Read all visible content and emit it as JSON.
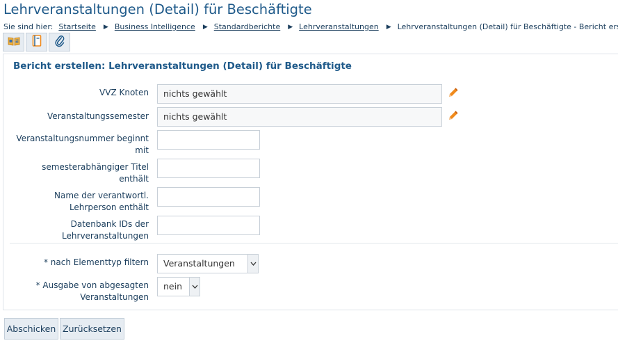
{
  "page": {
    "title": "Lehrveranstaltungen (Detail) für Beschäftigte"
  },
  "breadcrumb": {
    "lead": "Sie sind hier:",
    "items": [
      {
        "label": "Startseite",
        "link": true
      },
      {
        "label": "Business Intelligence",
        "link": true
      },
      {
        "label": "Standardberichte",
        "link": true
      },
      {
        "label": "Lehrveranstaltungen",
        "link": true
      },
      {
        "label": "Lehrveranstaltungen (Detail) für Beschäftigte - Bericht erstellen",
        "link": false
      }
    ]
  },
  "toolbar": {
    "icons": [
      "report-book-icon",
      "notebook-icon",
      "paperclip-icon"
    ]
  },
  "form": {
    "title": "Bericht erstellen: Lehrveranstaltungen (Detail) für Beschäftigte",
    "fields": {
      "vvz_knoten": {
        "label": "VVZ Knoten",
        "value": "nichts gewählt"
      },
      "semester": {
        "label": "Veranstaltungssemester",
        "value": "nichts gewählt"
      },
      "nummer": {
        "label": "Veranstaltungsnummer beginnt mit",
        "value": ""
      },
      "titel": {
        "label": "semesterabhängiger Titel enthält",
        "value": ""
      },
      "lehrperson": {
        "label": "Name der verantwortl. Lehrperson enthält",
        "value": ""
      },
      "db_ids": {
        "label": "Datenbank IDs der Lehrveranstaltungen",
        "value": ""
      },
      "elementtyp": {
        "label": "* nach Elementtyp filtern",
        "value": "Veranstaltungen"
      },
      "abgesagt": {
        "label": "* Ausgabe von abgesagten Veranstaltungen",
        "value": "nein"
      }
    }
  },
  "buttons": {
    "submit": "Abschicken",
    "reset": "Zurücksetzen"
  },
  "colors": {
    "title": "#1f5a8a",
    "pencil": "#f08a1c"
  }
}
